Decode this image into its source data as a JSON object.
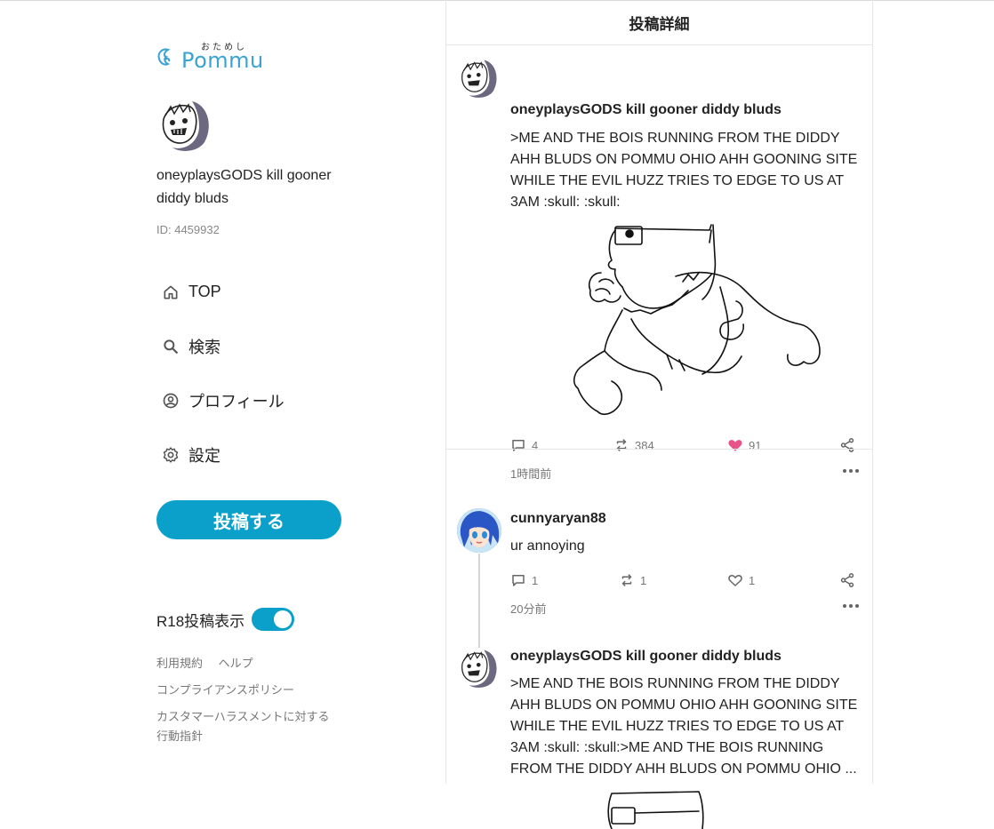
{
  "logo": {
    "brand": "Pommu",
    "kana": "おためし"
  },
  "sidebar": {
    "user_name": "oneyplaysGODS kill gooner diddy bluds",
    "user_id": "ID: 4459932",
    "nav": [
      {
        "label": "TOP",
        "icon": "home-icon"
      },
      {
        "label": "検索",
        "icon": "search-icon"
      },
      {
        "label": "プロフィール",
        "icon": "profile-icon"
      },
      {
        "label": "設定",
        "icon": "gear-icon"
      }
    ],
    "post_button": "投稿する",
    "r18_label": "R18投稿表示",
    "r18_enabled": true,
    "links": {
      "terms": "利用規約",
      "help": "ヘルプ",
      "compliance": "コンプライアンスポリシー",
      "harassment": "カスタマーハラスメントに対する行動指針"
    }
  },
  "main": {
    "header": "投稿詳細",
    "posts": [
      {
        "author": "oneyplaysGODS kill gooner diddy bluds",
        "text": ">ME AND THE BOIS RUNNING FROM THE DIDDY AHH BLUDS ON POMMU OHIO AHH GOONING SITE WHILE THE EVIL HUZZ TRIES TO EDGE TO US AT 3AM :skull: :skull:",
        "comments": "4",
        "reposts": "384",
        "likes": "91",
        "liked": true,
        "time": "1時間前"
      },
      {
        "author": "cunnyaryan88",
        "text": "ur annoying",
        "comments": "1",
        "reposts": "1",
        "likes": "1",
        "liked": false,
        "time": "20分前"
      },
      {
        "author": "oneyplaysGODS kill gooner diddy bluds",
        "text": ">ME AND THE BOIS RUNNING FROM THE DIDDY AHH BLUDS ON POMMU OHIO AHH GOONING SITE WHILE THE EVIL HUZZ TRIES TO EDGE TO US AT 3AM :skull: :skull:>ME AND THE BOIS RUNNING FROM THE DIDDY AHH BLUDS ON POMMU OHIO ..."
      }
    ]
  },
  "colors": {
    "accent": "#0aa0c9",
    "like": "#e8528a",
    "brand": "#3aa3d3"
  }
}
